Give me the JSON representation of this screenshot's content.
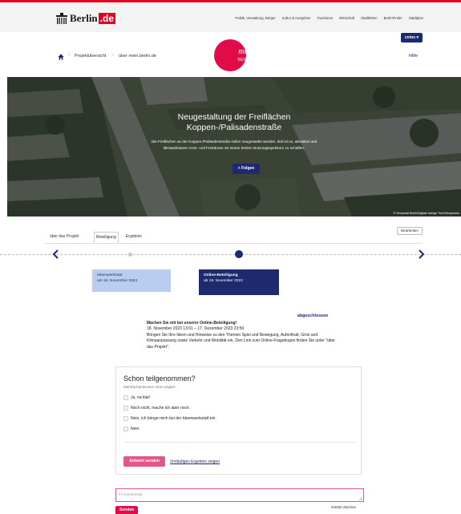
{
  "topbar": {
    "logo_word": "Berlin",
    "logo_suffix": ".de",
    "nav": [
      "Politik, Verwaltung, Bürger",
      "Kultur & Ausgehen",
      "Tourismus",
      "Wirtschaft",
      "Stadtleben",
      "BerlinFinder",
      "Stadtplan"
    ],
    "accent_color": "#e40422"
  },
  "header": {
    "breadcrumbs": [
      "Projektübersicht",
      "über mein.berlin.de"
    ],
    "logo_line1": "mein",
    "logo_line2": "BERLIN",
    "user_button": "cetos ▾",
    "help": "Hilfe",
    "brand_color": "#e20b47",
    "primary_color": "#1d2a6e"
  },
  "hero": {
    "title_line1": "Neugestaltung der Freiflächen",
    "title_line2": "Koppen-/Palisadenstraße",
    "description": "Die Freiflächen an der Koppen-/Palisadenstraße sollen neugestaltet werden. Ziel ist es, attraktive und klimawirksame Grün- und Freiräume mit einem breiten Nutzungsspektrum zu schaffen.",
    "follow_button": "+ Folgen",
    "credit": "© Geoportal Berlin/Digitale farbige TrueOrthophotos"
  },
  "tabs": {
    "items": [
      "über das Projekt",
      "Beteiligung",
      "Ergebnis"
    ],
    "active": "Beteiligung",
    "edit_button": "Bearbeiten"
  },
  "timeline": {
    "phases": [
      {
        "title": "Ideenwerkstatt",
        "date": "am 18. November 2023",
        "active": false
      },
      {
        "title": "Online-Beteiligung",
        "date": "ab 18. November 2023",
        "active": true
      }
    ]
  },
  "phase_info": {
    "status": "abgeschlossen",
    "title": "Machen Sie mit bei unserer Online-Beteiligung!",
    "dates": "18. November 2023 13:01 – 17. Dezember 2023 23:59",
    "text": "Bringen Sie Ihre Ideen und Hinweise zu den Themen Spiel und Bewegung, Aufenthalt, Grün und Klimaanpassung sowie Verkehr und Mobilität ein. Den Link zum Online-Fragebogen finden Sie unter \"über das Projekt\"."
  },
  "poll": {
    "question": "Schon teilgenommen?",
    "hint": "Mehrfachantworten sind möglich.",
    "options": [
      "Ja, na klar!",
      "Noch nicht, mache ich aber noch.",
      "Nein, ich bringe mich bei der Ideenwerkstatt ein.",
      "Nein."
    ],
    "submit_button": "Antwort senden",
    "result_link": "Vorläufiges Ergebnis zeigen"
  },
  "comment": {
    "placeholder": "Ihr Kommentar",
    "send_button": "Senden",
    "char_count": "0/4000 Zeichen"
  }
}
